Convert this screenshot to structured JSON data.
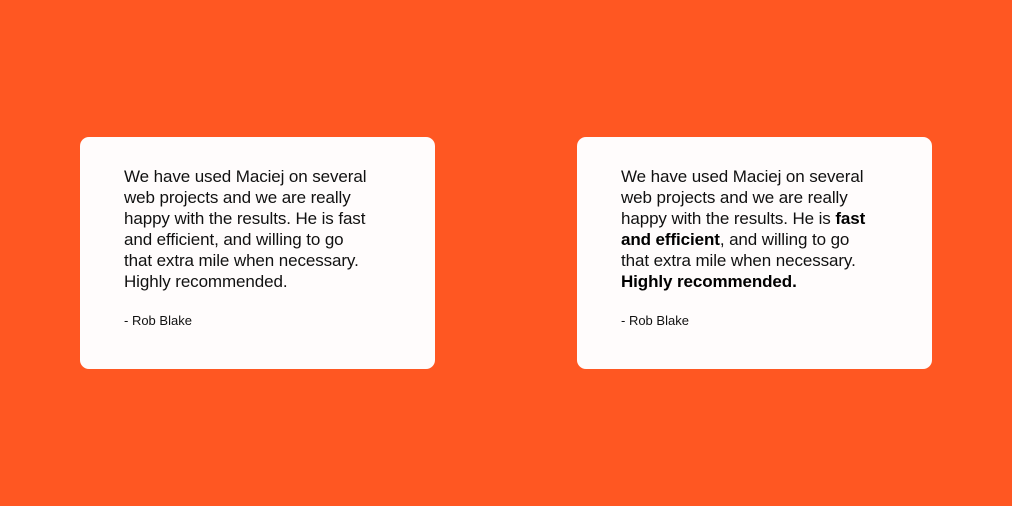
{
  "cards": [
    {
      "quote_lines": [
        "We have used Maciej on several",
        "web projects and we are really",
        "happy with the results. He is fast",
        "and efficient, and willing to go",
        "that extra mile when necessary.",
        "Highly recommended."
      ],
      "author": "- Rob Blake"
    },
    {
      "quote_lines": [
        {
          "parts": [
            "We have used Maciej on several"
          ]
        },
        {
          "parts": [
            "web projects and we are really"
          ]
        },
        {
          "parts": [
            "happy with the results. He is ",
            "fast"
          ]
        },
        {
          "parts": [
            "and efficient",
            ", and willing to go"
          ]
        },
        {
          "parts": [
            "that extra mile when necessary."
          ]
        },
        {
          "parts": [
            "Highly recommended."
          ]
        }
      ],
      "author": "- Rob Blake"
    }
  ],
  "colors": {
    "background": "#FF5722",
    "card": "#FFFCFC",
    "text": "#111111"
  }
}
